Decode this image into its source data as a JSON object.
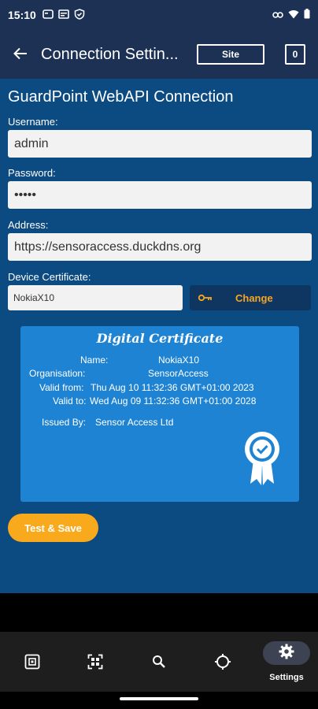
{
  "status": {
    "time": "15:10"
  },
  "appbar": {
    "title": "Connection Settin...",
    "site_label": "Site",
    "count_label": "0"
  },
  "form": {
    "section_title": "GuardPoint WebAPI Connection",
    "username_label": "Username:",
    "username_value": "admin",
    "password_label": "Password:",
    "password_value": "•••••",
    "address_label": "Address:",
    "address_value": "https://sensoraccess.duckdns.org",
    "certificate_label": "Device Certificate:",
    "certificate_value": "NokiaX10",
    "change_label": "Change"
  },
  "certificate": {
    "title": "Digital Certificate",
    "name_label": "Name:",
    "name_value": "NokiaX10",
    "org_label": "Organisation:",
    "org_value": "SensorAccess",
    "valid_from_label": "Valid from:",
    "valid_from_value": "Thu Aug 10 11:32:36 GMT+01:00 2023",
    "valid_to_label": "Valid to:",
    "valid_to_value": "Wed Aug 09 11:32:36 GMT+01:00 2028",
    "issued_label": "Issued By:",
    "issued_value": "Sensor Access Ltd"
  },
  "actions": {
    "save_label": "Test & Save"
  },
  "nav": {
    "items": [
      {
        "icon": "access-card-icon"
      },
      {
        "icon": "qr-scan-icon"
      },
      {
        "icon": "search-icon"
      },
      {
        "icon": "target-icon"
      },
      {
        "icon": "gear-icon",
        "label": "Settings"
      }
    ]
  },
  "colors": {
    "header": "#1d3155",
    "content": "#0c4a82",
    "card": "#1e83d3",
    "accent": "#f8a91c"
  }
}
